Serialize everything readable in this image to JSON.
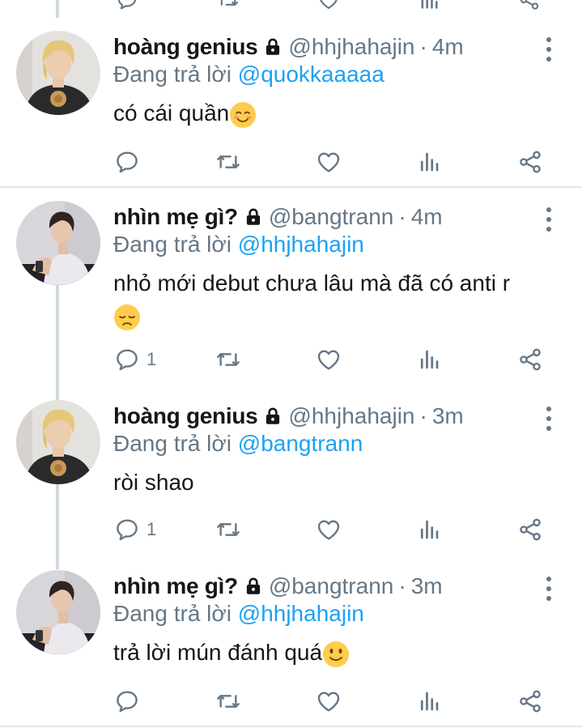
{
  "colors": {
    "name": "#14171a",
    "muted": "#657786",
    "link": "#1da1f2",
    "line": "#cfd9de",
    "emoji": "#ffcc4d"
  },
  "tweets": [
    {
      "name": "hoàng genius",
      "handle": "@hhjhahajin",
      "time": "4m",
      "reply_prefix": "Đang trả lời",
      "mention": "@quokkaaaaa",
      "text_line1": "có cái quần",
      "text_line2": "",
      "emoji": "smiling-blush-emoji",
      "reply_count": "",
      "avatar": "blond-avatar"
    },
    {
      "name": "nhìn mẹ gì?",
      "handle": "@bangtrann",
      "time": "4m",
      "reply_prefix": "Đang trả lời",
      "mention": "@hhjhahajin",
      "text_line1": "nhỏ mới debut chưa lâu mà đã có anti r",
      "text_line2": "",
      "emoji": "pensive-emoji",
      "reply_count": "1",
      "avatar": "dark-hair-avatar"
    },
    {
      "name": "hoàng genius",
      "handle": "@hhjhahajin",
      "time": "3m",
      "reply_prefix": "Đang trả lời",
      "mention": "@bangtrann",
      "text_line1": "ròi shao",
      "text_line2": "",
      "emoji": "",
      "reply_count": "1",
      "avatar": "blond-avatar"
    },
    {
      "name": "nhìn mẹ gì?",
      "handle": "@bangtrann",
      "time": "3m",
      "reply_prefix": "Đang trả lời",
      "mention": "@hhjhahajin",
      "text_line1": "trả lời mún đánh quá",
      "text_line2": "",
      "emoji": "slight-smile-emoji",
      "reply_count": "",
      "avatar": "dark-hair-avatar"
    }
  ],
  "action_icons": [
    "reply-icon",
    "retweet-icon",
    "like-icon",
    "analytics-icon",
    "share-icon"
  ]
}
